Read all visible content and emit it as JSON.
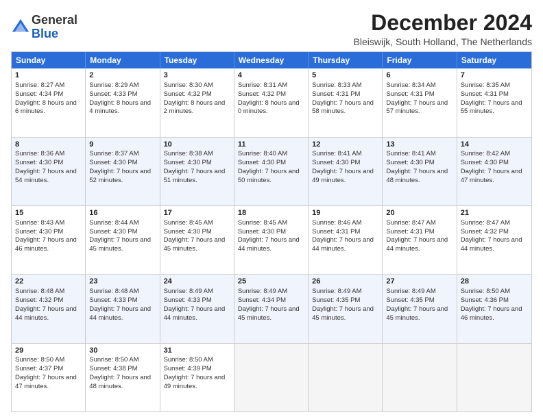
{
  "logo": {
    "text_general": "General",
    "text_blue": "Blue"
  },
  "title": "December 2024",
  "subtitle": "Bleiswijk, South Holland, The Netherlands",
  "header_days": [
    "Sunday",
    "Monday",
    "Tuesday",
    "Wednesday",
    "Thursday",
    "Friday",
    "Saturday"
  ],
  "weeks": [
    [
      {
        "day": "1",
        "rise": "Sunrise: 8:27 AM",
        "set": "Sunset: 4:34 PM",
        "daylight": "Daylight: 8 hours and 6 minutes."
      },
      {
        "day": "2",
        "rise": "Sunrise: 8:29 AM",
        "set": "Sunset: 4:33 PM",
        "daylight": "Daylight: 8 hours and 4 minutes."
      },
      {
        "day": "3",
        "rise": "Sunrise: 8:30 AM",
        "set": "Sunset: 4:32 PM",
        "daylight": "Daylight: 8 hours and 2 minutes."
      },
      {
        "day": "4",
        "rise": "Sunrise: 8:31 AM",
        "set": "Sunset: 4:32 PM",
        "daylight": "Daylight: 8 hours and 0 minutes."
      },
      {
        "day": "5",
        "rise": "Sunrise: 8:33 AM",
        "set": "Sunset: 4:31 PM",
        "daylight": "Daylight: 7 hours and 58 minutes."
      },
      {
        "day": "6",
        "rise": "Sunrise: 8:34 AM",
        "set": "Sunset: 4:31 PM",
        "daylight": "Daylight: 7 hours and 57 minutes."
      },
      {
        "day": "7",
        "rise": "Sunrise: 8:35 AM",
        "set": "Sunset: 4:31 PM",
        "daylight": "Daylight: 7 hours and 55 minutes."
      }
    ],
    [
      {
        "day": "8",
        "rise": "Sunrise: 8:36 AM",
        "set": "Sunset: 4:30 PM",
        "daylight": "Daylight: 7 hours and 54 minutes."
      },
      {
        "day": "9",
        "rise": "Sunrise: 8:37 AM",
        "set": "Sunset: 4:30 PM",
        "daylight": "Daylight: 7 hours and 52 minutes."
      },
      {
        "day": "10",
        "rise": "Sunrise: 8:38 AM",
        "set": "Sunset: 4:30 PM",
        "daylight": "Daylight: 7 hours and 51 minutes."
      },
      {
        "day": "11",
        "rise": "Sunrise: 8:40 AM",
        "set": "Sunset: 4:30 PM",
        "daylight": "Daylight: 7 hours and 50 minutes."
      },
      {
        "day": "12",
        "rise": "Sunrise: 8:41 AM",
        "set": "Sunset: 4:30 PM",
        "daylight": "Daylight: 7 hours and 49 minutes."
      },
      {
        "day": "13",
        "rise": "Sunrise: 8:41 AM",
        "set": "Sunset: 4:30 PM",
        "daylight": "Daylight: 7 hours and 48 minutes."
      },
      {
        "day": "14",
        "rise": "Sunrise: 8:42 AM",
        "set": "Sunset: 4:30 PM",
        "daylight": "Daylight: 7 hours and 47 minutes."
      }
    ],
    [
      {
        "day": "15",
        "rise": "Sunrise: 8:43 AM",
        "set": "Sunset: 4:30 PM",
        "daylight": "Daylight: 7 hours and 46 minutes."
      },
      {
        "day": "16",
        "rise": "Sunrise: 8:44 AM",
        "set": "Sunset: 4:30 PM",
        "daylight": "Daylight: 7 hours and 45 minutes."
      },
      {
        "day": "17",
        "rise": "Sunrise: 8:45 AM",
        "set": "Sunset: 4:30 PM",
        "daylight": "Daylight: 7 hours and 45 minutes."
      },
      {
        "day": "18",
        "rise": "Sunrise: 8:45 AM",
        "set": "Sunset: 4:30 PM",
        "daylight": "Daylight: 7 hours and 44 minutes."
      },
      {
        "day": "19",
        "rise": "Sunrise: 8:46 AM",
        "set": "Sunset: 4:31 PM",
        "daylight": "Daylight: 7 hours and 44 minutes."
      },
      {
        "day": "20",
        "rise": "Sunrise: 8:47 AM",
        "set": "Sunset: 4:31 PM",
        "daylight": "Daylight: 7 hours and 44 minutes."
      },
      {
        "day": "21",
        "rise": "Sunrise: 8:47 AM",
        "set": "Sunset: 4:32 PM",
        "daylight": "Daylight: 7 hours and 44 minutes."
      }
    ],
    [
      {
        "day": "22",
        "rise": "Sunrise: 8:48 AM",
        "set": "Sunset: 4:32 PM",
        "daylight": "Daylight: 7 hours and 44 minutes."
      },
      {
        "day": "23",
        "rise": "Sunrise: 8:48 AM",
        "set": "Sunset: 4:33 PM",
        "daylight": "Daylight: 7 hours and 44 minutes."
      },
      {
        "day": "24",
        "rise": "Sunrise: 8:49 AM",
        "set": "Sunset: 4:33 PM",
        "daylight": "Daylight: 7 hours and 44 minutes."
      },
      {
        "day": "25",
        "rise": "Sunrise: 8:49 AM",
        "set": "Sunset: 4:34 PM",
        "daylight": "Daylight: 7 hours and 45 minutes."
      },
      {
        "day": "26",
        "rise": "Sunrise: 8:49 AM",
        "set": "Sunset: 4:35 PM",
        "daylight": "Daylight: 7 hours and 45 minutes."
      },
      {
        "day": "27",
        "rise": "Sunrise: 8:49 AM",
        "set": "Sunset: 4:35 PM",
        "daylight": "Daylight: 7 hours and 45 minutes."
      },
      {
        "day": "28",
        "rise": "Sunrise: 8:50 AM",
        "set": "Sunset: 4:36 PM",
        "daylight": "Daylight: 7 hours and 46 minutes."
      }
    ],
    [
      {
        "day": "29",
        "rise": "Sunrise: 8:50 AM",
        "set": "Sunset: 4:37 PM",
        "daylight": "Daylight: 7 hours and 47 minutes."
      },
      {
        "day": "30",
        "rise": "Sunrise: 8:50 AM",
        "set": "Sunset: 4:38 PM",
        "daylight": "Daylight: 7 hours and 48 minutes."
      },
      {
        "day": "31",
        "rise": "Sunrise: 8:50 AM",
        "set": "Sunset: 4:39 PM",
        "daylight": "Daylight: 7 hours and 49 minutes."
      },
      {
        "day": "",
        "rise": "",
        "set": "",
        "daylight": ""
      },
      {
        "day": "",
        "rise": "",
        "set": "",
        "daylight": ""
      },
      {
        "day": "",
        "rise": "",
        "set": "",
        "daylight": ""
      },
      {
        "day": "",
        "rise": "",
        "set": "",
        "daylight": ""
      }
    ]
  ]
}
